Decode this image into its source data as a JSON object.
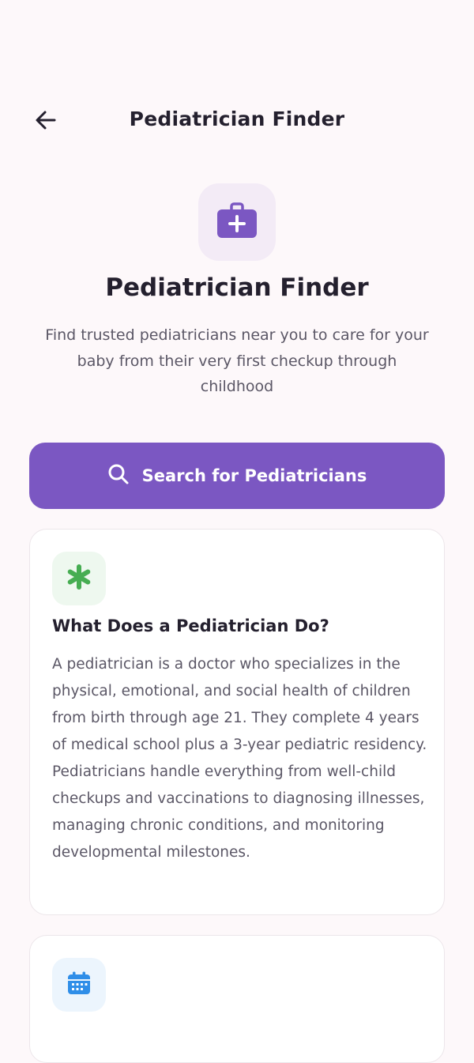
{
  "header": {
    "title": "Pediatrician Finder",
    "back_icon": "arrow-left-icon"
  },
  "hero": {
    "icon": "medical-kit-icon",
    "title": "Pediatrician Finder",
    "subtitle": "Find trusted pediatricians near you to care for your baby from their very first checkup through childhood"
  },
  "search_button": {
    "icon": "search-icon",
    "label": "Search for Pediatricians"
  },
  "cards": [
    {
      "icon": "asterisk-icon",
      "title": "What Does a Pediatrician Do?",
      "body": "A pediatrician is a doctor who specializes in the physical, emotional, and social health of children from birth through age 21. They complete 4 years of medical school plus a 3-year pediatric residency. Pediatricians handle everything from well-child checkups and vaccinations to diagnosing illnesses, managing chronic conditions, and monitoring developmental milestones."
    },
    {
      "icon": "calendar-icon"
    }
  ],
  "colors": {
    "background": "#fdf8fa",
    "primary": "#7b57c2",
    "text_dark": "#24202e",
    "text_muted": "#5b5766",
    "green_accent": "#46ad52",
    "blue_accent": "#2f8ee8"
  }
}
